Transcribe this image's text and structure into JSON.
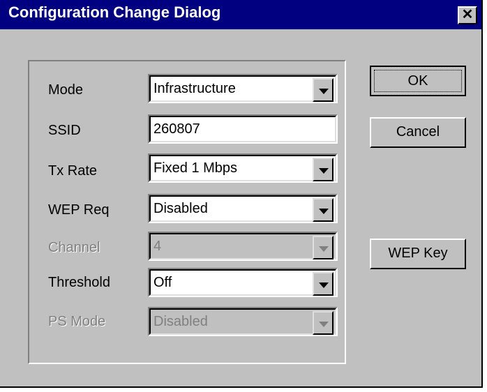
{
  "window": {
    "title": "Configuration Change Dialog",
    "close_glyph": "✕"
  },
  "fields": [
    {
      "label": "Mode",
      "value": "Infrastructure",
      "type": "dropdown",
      "enabled": true
    },
    {
      "label": "SSID",
      "value": "260807",
      "type": "text",
      "enabled": true
    },
    {
      "label": "Tx Rate",
      "value": "Fixed 1 Mbps",
      "type": "dropdown",
      "enabled": true
    },
    {
      "label": "WEP Req",
      "value": "Disabled",
      "type": "dropdown",
      "enabled": true
    },
    {
      "label": "Channel",
      "value": "4",
      "type": "dropdown",
      "enabled": false
    },
    {
      "label": "Threshold",
      "value": "Off",
      "type": "dropdown",
      "enabled": true
    },
    {
      "label": "PS Mode",
      "value": "Disabled",
      "type": "dropdown",
      "enabled": false
    }
  ],
  "buttons": {
    "ok": "OK",
    "cancel": "Cancel",
    "wep_key": "WEP Key"
  },
  "colors": {
    "titlebar": "#000080",
    "face": "#c0c0c0",
    "disabled_text": "#808080"
  }
}
